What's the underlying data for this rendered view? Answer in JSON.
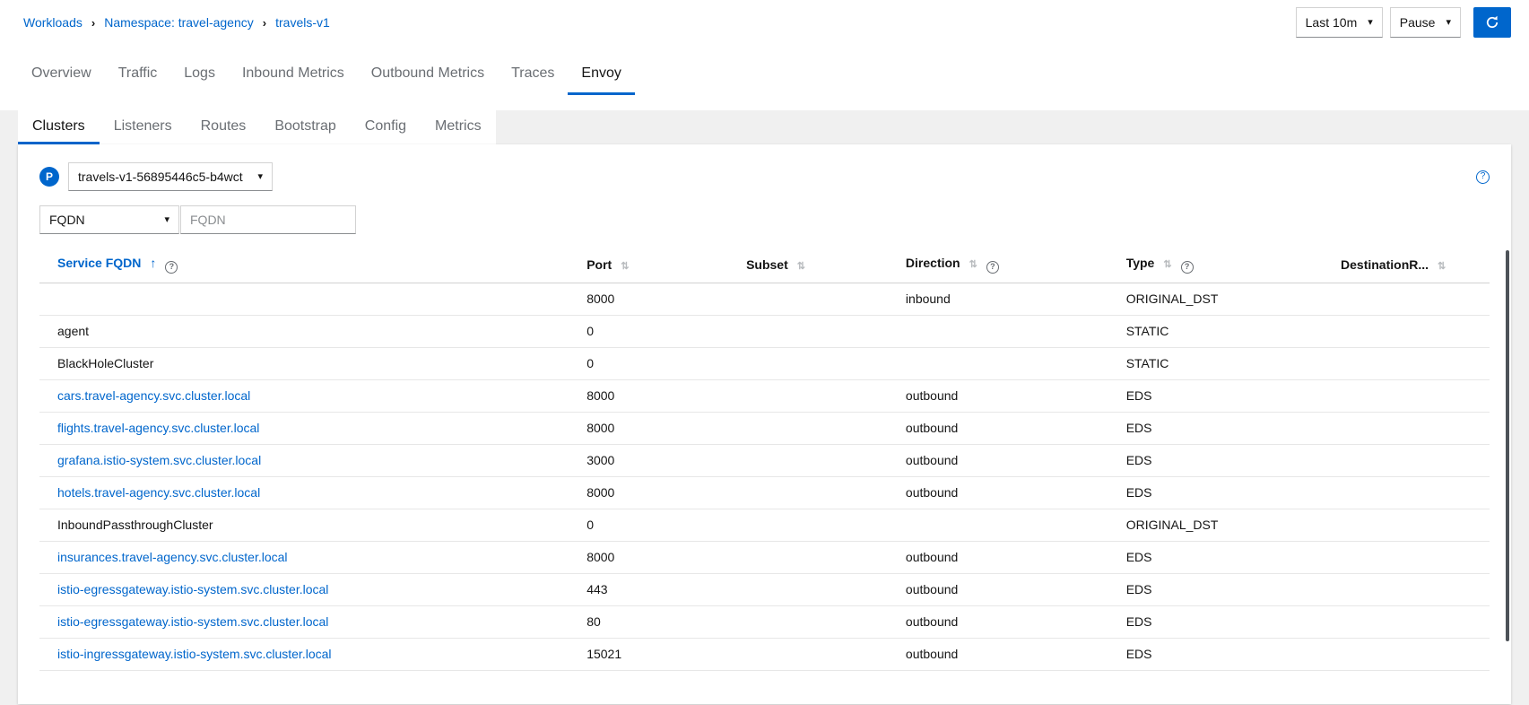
{
  "breadcrumb": {
    "items": [
      {
        "label": "Workloads"
      },
      {
        "label": "Namespace: travel-agency"
      },
      {
        "label": "travels-v1"
      }
    ]
  },
  "toolbar": {
    "duration_label": "Last 10m",
    "refresh_interval_label": "Pause"
  },
  "main_tabs": [
    {
      "label": "Overview",
      "active": false
    },
    {
      "label": "Traffic",
      "active": false
    },
    {
      "label": "Logs",
      "active": false
    },
    {
      "label": "Inbound Metrics",
      "active": false
    },
    {
      "label": "Outbound Metrics",
      "active": false
    },
    {
      "label": "Traces",
      "active": false
    },
    {
      "label": "Envoy",
      "active": true
    }
  ],
  "envoy_tabs": [
    {
      "label": "Clusters",
      "active": true
    },
    {
      "label": "Listeners",
      "active": false
    },
    {
      "label": "Routes",
      "active": false
    },
    {
      "label": "Bootstrap",
      "active": false
    },
    {
      "label": "Config",
      "active": false
    },
    {
      "label": "Metrics",
      "active": false
    }
  ],
  "pod_selector": {
    "badge": "P",
    "selected": "travels-v1-56895446c5-b4wct"
  },
  "filter": {
    "selected_type": "FQDN",
    "input_placeholder": "FQDN",
    "input_value": ""
  },
  "table": {
    "columns": [
      {
        "label": "Service FQDN",
        "sorted": "asc",
        "sortable": true,
        "help": true
      },
      {
        "label": "Port",
        "sortable": true,
        "help": false
      },
      {
        "label": "Subset",
        "sortable": true,
        "help": false
      },
      {
        "label": "Direction",
        "sortable": true,
        "help": true
      },
      {
        "label": "Type",
        "sortable": true,
        "help": true
      },
      {
        "label": "DestinationR...",
        "sortable": true,
        "help": false
      }
    ],
    "rows": [
      {
        "service_fqdn": "",
        "link": false,
        "port": "8000",
        "subset": "",
        "direction": "inbound",
        "type": "ORIGINAL_DST",
        "destination_rule": ""
      },
      {
        "service_fqdn": "agent",
        "link": false,
        "port": "0",
        "subset": "",
        "direction": "",
        "type": "STATIC",
        "destination_rule": ""
      },
      {
        "service_fqdn": "BlackHoleCluster",
        "link": false,
        "port": "0",
        "subset": "",
        "direction": "",
        "type": "STATIC",
        "destination_rule": ""
      },
      {
        "service_fqdn": "cars.travel-agency.svc.cluster.local",
        "link": true,
        "port": "8000",
        "subset": "",
        "direction": "outbound",
        "type": "EDS",
        "destination_rule": ""
      },
      {
        "service_fqdn": "flights.travel-agency.svc.cluster.local",
        "link": true,
        "port": "8000",
        "subset": "",
        "direction": "outbound",
        "type": "EDS",
        "destination_rule": ""
      },
      {
        "service_fqdn": "grafana.istio-system.svc.cluster.local",
        "link": true,
        "port": "3000",
        "subset": "",
        "direction": "outbound",
        "type": "EDS",
        "destination_rule": ""
      },
      {
        "service_fqdn": "hotels.travel-agency.svc.cluster.local",
        "link": true,
        "port": "8000",
        "subset": "",
        "direction": "outbound",
        "type": "EDS",
        "destination_rule": ""
      },
      {
        "service_fqdn": "InboundPassthroughCluster",
        "link": false,
        "port": "0",
        "subset": "",
        "direction": "",
        "type": "ORIGINAL_DST",
        "destination_rule": ""
      },
      {
        "service_fqdn": "insurances.travel-agency.svc.cluster.local",
        "link": true,
        "port": "8000",
        "subset": "",
        "direction": "outbound",
        "type": "EDS",
        "destination_rule": ""
      },
      {
        "service_fqdn": "istio-egressgateway.istio-system.svc.cluster.local",
        "link": true,
        "port": "443",
        "subset": "",
        "direction": "outbound",
        "type": "EDS",
        "destination_rule": ""
      },
      {
        "service_fqdn": "istio-egressgateway.istio-system.svc.cluster.local",
        "link": true,
        "port": "80",
        "subset": "",
        "direction": "outbound",
        "type": "EDS",
        "destination_rule": ""
      },
      {
        "service_fqdn": "istio-ingressgateway.istio-system.svc.cluster.local",
        "link": true,
        "port": "15021",
        "subset": "",
        "direction": "outbound",
        "type": "EDS",
        "destination_rule": ""
      }
    ]
  },
  "icons": {
    "breadcrumb_separator": "›",
    "caret_down": "▾",
    "sort_asc": "↑",
    "sort_inactive": "⇅",
    "help": "?"
  },
  "colors": {
    "accent": "#0066cc",
    "link": "#0066cc",
    "badge": "#0066cc",
    "tab_inactive": "#6a6e73",
    "gray_background": "#f0f0f0"
  }
}
